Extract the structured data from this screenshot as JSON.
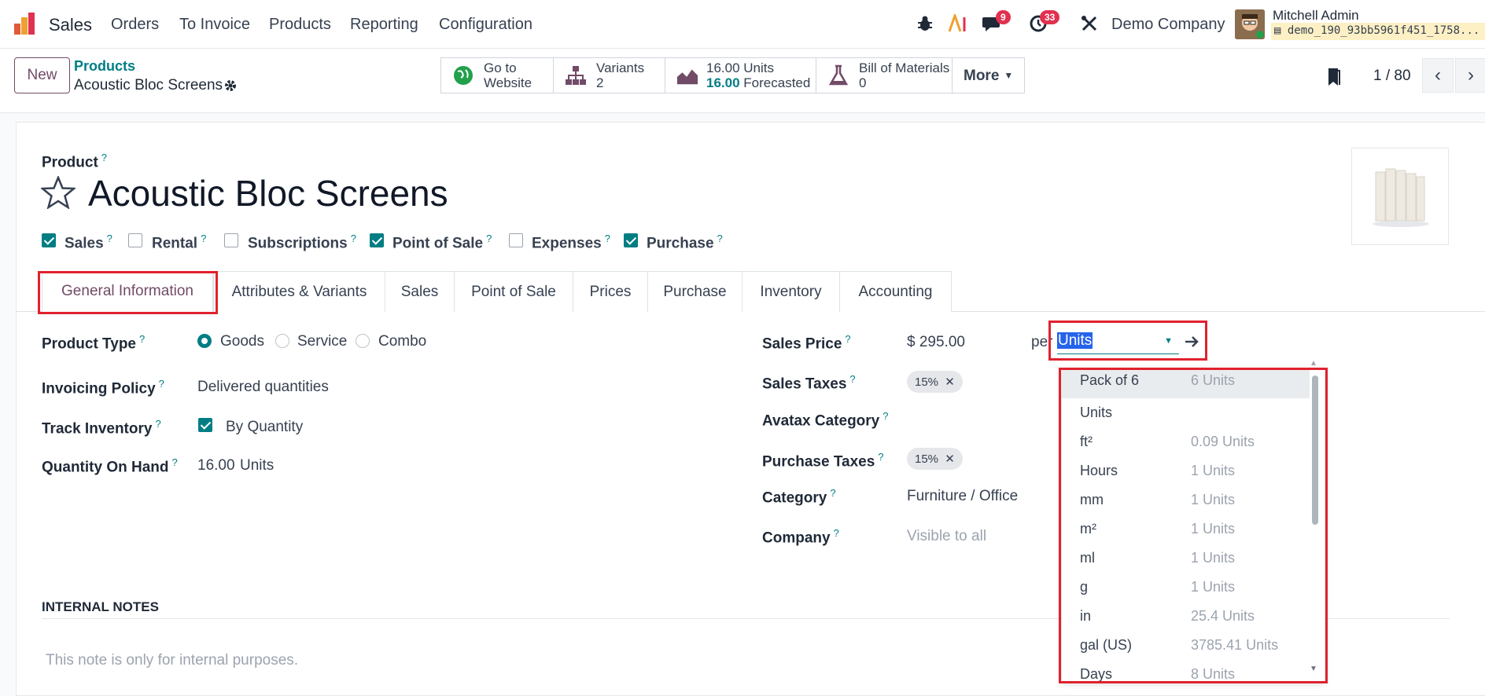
{
  "navbar": {
    "app_name": "Sales",
    "menu": [
      "Orders",
      "To Invoice",
      "Products",
      "Reporting",
      "Configuration"
    ],
    "messages_badge": "9",
    "activities_badge": "33",
    "company": "Demo Company",
    "user_name": "Mitchell Admin",
    "db_name": "demo_190_93bb5961f451_1758..."
  },
  "control": {
    "new_label": "New",
    "breadcrumb_parent": "Products",
    "breadcrumb_current": "Acoustic Bloc Screens",
    "website_line1": "Go to",
    "website_line2": "Website",
    "variants_label": "Variants",
    "variants_count": "2",
    "units_onhand": "16.00 Units",
    "forecast_value": "16.00",
    "forecast_label": "Forecasted",
    "bom_label": "Bill of Materials",
    "bom_count": "0",
    "more_label": "More",
    "pager": "1 / 80"
  },
  "product": {
    "label": "Product",
    "name": "Acoustic Bloc Screens",
    "checkboxes": [
      {
        "label": "Sales",
        "checked": true
      },
      {
        "label": "Rental",
        "checked": false
      },
      {
        "label": "Subscriptions",
        "checked": false
      },
      {
        "label": "Point of Sale",
        "checked": true
      },
      {
        "label": "Expenses",
        "checked": false
      },
      {
        "label": "Purchase",
        "checked": true
      }
    ]
  },
  "tabs": [
    "General Information",
    "Attributes & Variants",
    "Sales",
    "Point of Sale",
    "Prices",
    "Purchase",
    "Inventory",
    "Accounting"
  ],
  "left_fields": {
    "product_type_label": "Product Type",
    "type_options": [
      "Goods",
      "Service",
      "Combo"
    ],
    "type_selected": "Goods",
    "invoicing_label": "Invoicing Policy",
    "invoicing_value": "Delivered quantities",
    "track_label": "Track Inventory",
    "track_value": "By Quantity",
    "qty_label": "Quantity On Hand",
    "qty_value": "16.00",
    "qty_unit": "Units"
  },
  "right_fields": {
    "sales_price_label": "Sales Price",
    "sales_price_value": "$ 295.00",
    "per_label": "per",
    "uom_value": "Units",
    "sales_taxes_label": "Sales Taxes",
    "sales_tax_tag": "15%",
    "avatax_label": "Avatax Category",
    "purchase_taxes_label": "Purchase Taxes",
    "purchase_tax_tag": "15%",
    "category_label": "Category",
    "category_value": "Furniture / Office",
    "company_label": "Company",
    "company_placeholder": "Visible to all"
  },
  "notes": {
    "title": "INTERNAL NOTES",
    "placeholder": "This note is only for internal purposes."
  },
  "uom_dropdown": [
    {
      "name": "Pack of 6",
      "ratio": "6 Units"
    },
    {
      "name": "Units",
      "ratio": ""
    },
    {
      "name": "ft²",
      "ratio": "0.09 Units"
    },
    {
      "name": "Hours",
      "ratio": "1 Units"
    },
    {
      "name": "mm",
      "ratio": "1 Units"
    },
    {
      "name": "m²",
      "ratio": "1 Units"
    },
    {
      "name": "ml",
      "ratio": "1 Units"
    },
    {
      "name": "g",
      "ratio": "1 Units"
    },
    {
      "name": "in",
      "ratio": "25.4 Units"
    },
    {
      "name": "gal (US)",
      "ratio": "3785.41 Units"
    },
    {
      "name": "Days",
      "ratio": "8 Units"
    }
  ],
  "colors": {
    "accent": "#017e84",
    "brand": "#714b67",
    "highlight": "#e0222e"
  }
}
